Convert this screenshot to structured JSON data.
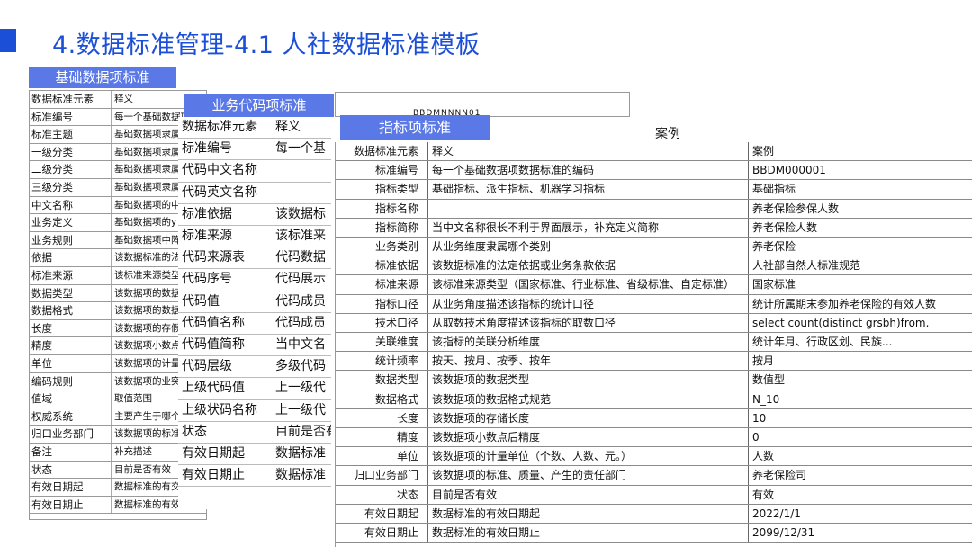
{
  "page": {
    "title": "4.数据标准管理-4.1 人社数据标准模板",
    "accent_color": "#1c4fd8",
    "header_color": "#5a79e6"
  },
  "sheet_basic": {
    "header": "基础数据项标准",
    "rows": [
      [
        "数据标准元素",
        "释义"
      ],
      [
        "标准编号",
        "每一个基础数据项数据标准的编"
      ],
      [
        "标准主题",
        "基础数据项隶属"
      ],
      [
        "一级分类",
        "基础数据项隶属"
      ],
      [
        "二级分类",
        "基础数据项隶属"
      ],
      [
        "三级分类",
        "基础数据项隶属"
      ],
      [
        "中文名称",
        "基础数据项的中"
      ],
      [
        "业务定义",
        "基础数据项的y"
      ],
      [
        "业务规则",
        "基础数据项中阵"
      ],
      [
        "依据",
        "该数据标准的法"
      ],
      [
        "标准来源",
        "该标准来源类型"
      ],
      [
        "数据类型",
        "该数据项的数据"
      ],
      [
        "数据格式",
        "该数据项的数据"
      ],
      [
        "长度",
        "该数据项的存假"
      ],
      [
        "精度",
        "该数据项小数点"
      ],
      [
        "单位",
        "该数据项的计量"
      ],
      [
        "编码规则",
        "该数据项的业突"
      ],
      [
        "值域",
        "取值范围"
      ],
      [
        "权威系统",
        "主要产生于哪个"
      ],
      [
        "归口业务部门",
        "该数据项的标准"
      ],
      [
        "备注",
        "补充描述"
      ],
      [
        "状态",
        "目前是否有效"
      ],
      [
        "有效日期起",
        "数据标准的有交"
      ],
      [
        "有效日期止",
        "数据标准的有效日期止"
      ]
    ]
  },
  "sheet_code": {
    "header": "业务代码项标准",
    "top_code": "BBDMNNNN01",
    "rows": [
      [
        "数据标准元素",
        "释义"
      ],
      [
        "标准编号",
        "每一个基"
      ],
      [
        "代码中文名称",
        ""
      ],
      [
        "代码英文名称",
        ""
      ],
      [
        "标准依据",
        "该数据标"
      ],
      [
        "标准来源",
        "该标准来"
      ],
      [
        "代码来源表",
        "代码数据"
      ],
      [
        "代码序号",
        "代码展示"
      ],
      [
        "代码值",
        "代码成员"
      ],
      [
        "代码值名称",
        "代码成员"
      ],
      [
        "代码值简称",
        "当中文名"
      ],
      [
        "代码层级",
        "多级代码"
      ],
      [
        "上级代码值",
        "上一级代"
      ],
      [
        "上级状码名称",
        "上一级代"
      ],
      [
        "状态",
        "目前是否有"
      ],
      [
        "有效日期起",
        "数据标准"
      ],
      [
        "有效日期止",
        "数据标准"
      ]
    ]
  },
  "sheet_indicator": {
    "header": "指标项标准",
    "case_header": "案例",
    "rows": [
      [
        "数据标准元素",
        "释义",
        "案例"
      ],
      [
        "标准编号",
        "每一个基础数据项数据标准的编码",
        "BBDM000001"
      ],
      [
        "指标类型",
        "基础指标、派生指标、机器学习指标",
        "基础指标"
      ],
      [
        "指标名称",
        "",
        "养老保险参保人数"
      ],
      [
        "指标简称",
        "当中文名称很长不利于界面展示，补充定义简称",
        "养老保险人数"
      ],
      [
        "业务类别",
        "从业务维度隶属哪个类别",
        "养老保险"
      ],
      [
        "标准依据",
        "该数据标准的法定依据或业务条款依据",
        "人社部自然人标准规范"
      ],
      [
        "标准来源",
        "该标准来源类型（国家标准、行业标准、省级标准、自定标准）",
        "国家标准"
      ],
      [
        "指标口径",
        "从业务角度描述该指标的统计口径",
        "统计所属期末参加养老保险的有效人数"
      ],
      [
        "技术口径",
        "从取数技术角度描述该指标的取数口径",
        "select count(distinct grsbh)from."
      ],
      [
        "关联维度",
        "该指标的关联分析维度",
        "统计年月、行政区划、民族..."
      ],
      [
        "统计频率",
        "按天、按月、按季、按年",
        "按月"
      ],
      [
        "数据类型",
        "该数据项的数据类型",
        "数值型"
      ],
      [
        "数据格式",
        "该数据项的数据格式规范",
        "N_10"
      ],
      [
        "长度",
        "该数据项的存储长度",
        "10"
      ],
      [
        "精度",
        "该数据项小数点后精度",
        "0"
      ],
      [
        "单位",
        "该数据项的计量单位（个数、人数、元。）",
        "人数"
      ],
      [
        "归口业务部门",
        "该数据项的标准、质量、产生的责任部门",
        "养老保险司"
      ],
      [
        "状态",
        "目前是否有效",
        "有效"
      ],
      [
        "有效日期起",
        "数据标准的有效日期起",
        "2022/1/1"
      ],
      [
        "有效日期止",
        "数据标准的有效日期止",
        "2099/12/31"
      ]
    ]
  }
}
